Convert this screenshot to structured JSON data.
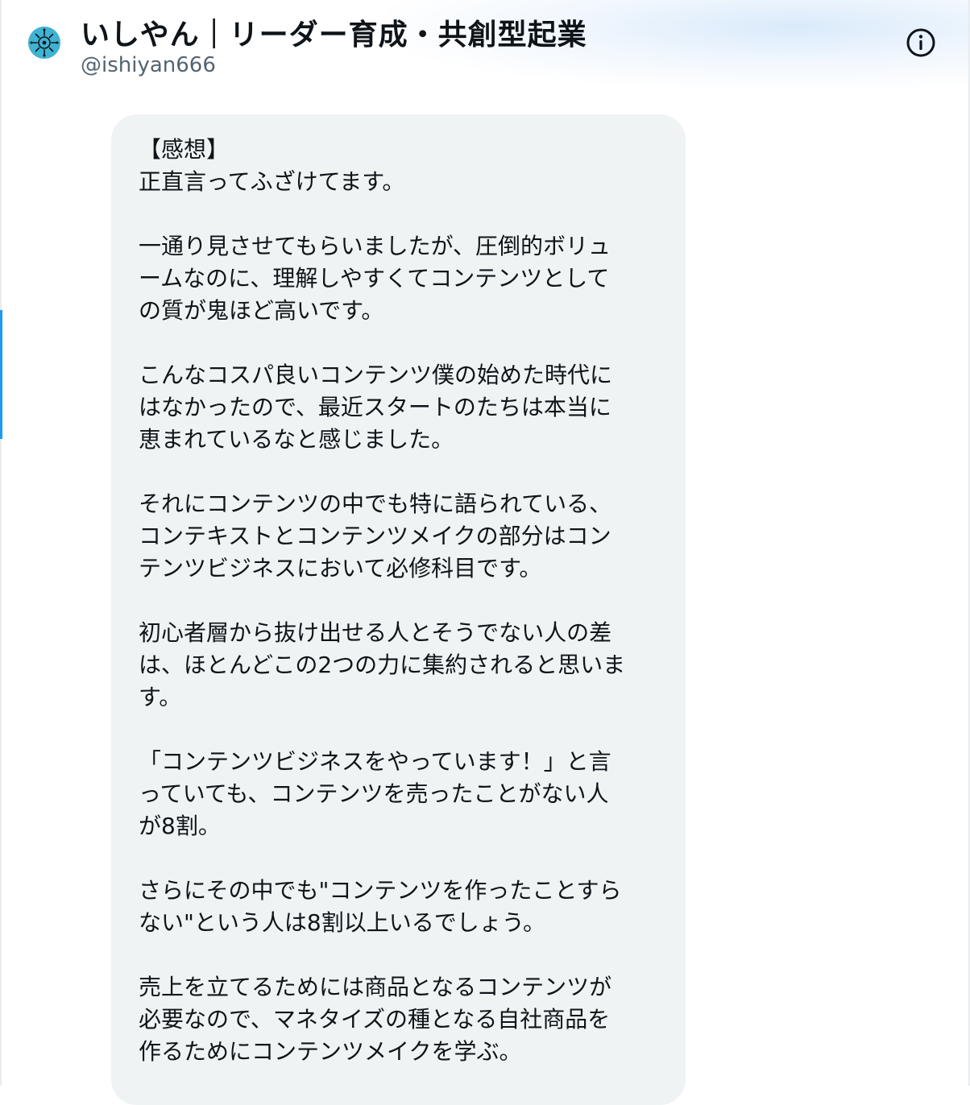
{
  "header": {
    "display_name": "いしやん｜リーダー育成・共創型起業",
    "handle": "@ishiyan666",
    "avatar_icon": "user-avatar",
    "info_icon": "info-circle-icon"
  },
  "message": {
    "text": "【感想】\n正直言ってふざけてます。\n\n一通り見させてもらいましたが、圧倒的ボリュ\nームなのに、理解しやすくてコンテンツとして\nの質が鬼ほど高いです。\n\nこんなコスパ良いコンテンツ僕の始めた時代に\nはなかったので、最近スタートのたちは本当に\n恵まれているなと感じました。\n\nそれにコンテンツの中でも特に語られている、\nコンテキストとコンテンツメイクの部分はコン\nテンツビジネスにおいて必修科目です。\n\n初心者層から抜け出せる人とそうでない人の差\nは、ほとんどこの2つの力に集約されると思いま\nす。\n\n「コンテンツビジネスをやっています！」と言\nっていても、コンテンツを売ったことがない人\nが8割。\n\nさらにその中でも\"コンテンツを作ったことすら\nない\"という人は8割以上いるでしょう。\n\n売上を立てるためには商品となるコンテンツが\n必要なので、マネタイズの種となる自社商品を\n作るためにコンテンツメイクを学ぶ。"
  },
  "colors": {
    "bubble_bg": "#eff3f4",
    "text_primary": "#0f1419",
    "text_secondary": "#536471",
    "avatar_bg": "#3fb3d3"
  }
}
